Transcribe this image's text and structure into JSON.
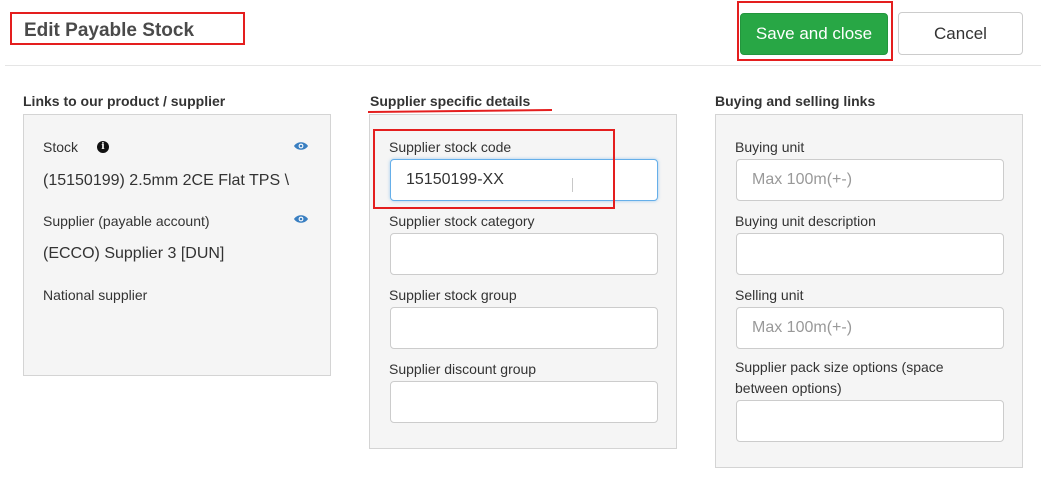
{
  "header": {
    "title": "Edit Payable Stock",
    "save_label": "Save and close",
    "cancel_label": "Cancel"
  },
  "links_section": {
    "title": "Links to our product / supplier",
    "stock_label": "Stock",
    "stock_value": "(15150199) 2.5mm 2CE Flat TPS \\",
    "supplier_label": "Supplier (payable account)",
    "supplier_value": "(ECCO) Supplier 3 [DUN]",
    "note": "National supplier"
  },
  "supplier_section": {
    "title": "Supplier specific details",
    "fields": [
      {
        "label": "Supplier stock code",
        "value": "15150199-XX",
        "placeholder": ""
      },
      {
        "label": "Supplier stock category",
        "value": "",
        "placeholder": ""
      },
      {
        "label": "Supplier stock group",
        "value": "",
        "placeholder": ""
      },
      {
        "label": "Supplier discount group",
        "value": "",
        "placeholder": ""
      }
    ]
  },
  "buying_section": {
    "title": "Buying and selling links",
    "fields": [
      {
        "label": "Buying unit",
        "value": "",
        "placeholder": "Max 100m(+-)"
      },
      {
        "label": "Buying unit description",
        "value": "",
        "placeholder": ""
      },
      {
        "label": "Selling unit",
        "value": "",
        "placeholder": "Max 100m(+-)"
      },
      {
        "label_line1": "Supplier pack size options (space",
        "label_line2": "between options)",
        "value": "",
        "placeholder": ""
      }
    ]
  },
  "colors": {
    "save_button": "#28a745",
    "annotation_red": "#e41e1e",
    "eye_icon": "#3a7fc1",
    "focus_border": "#66afe9"
  },
  "icons": {
    "info": "info-icon",
    "eye": "eye-icon"
  }
}
